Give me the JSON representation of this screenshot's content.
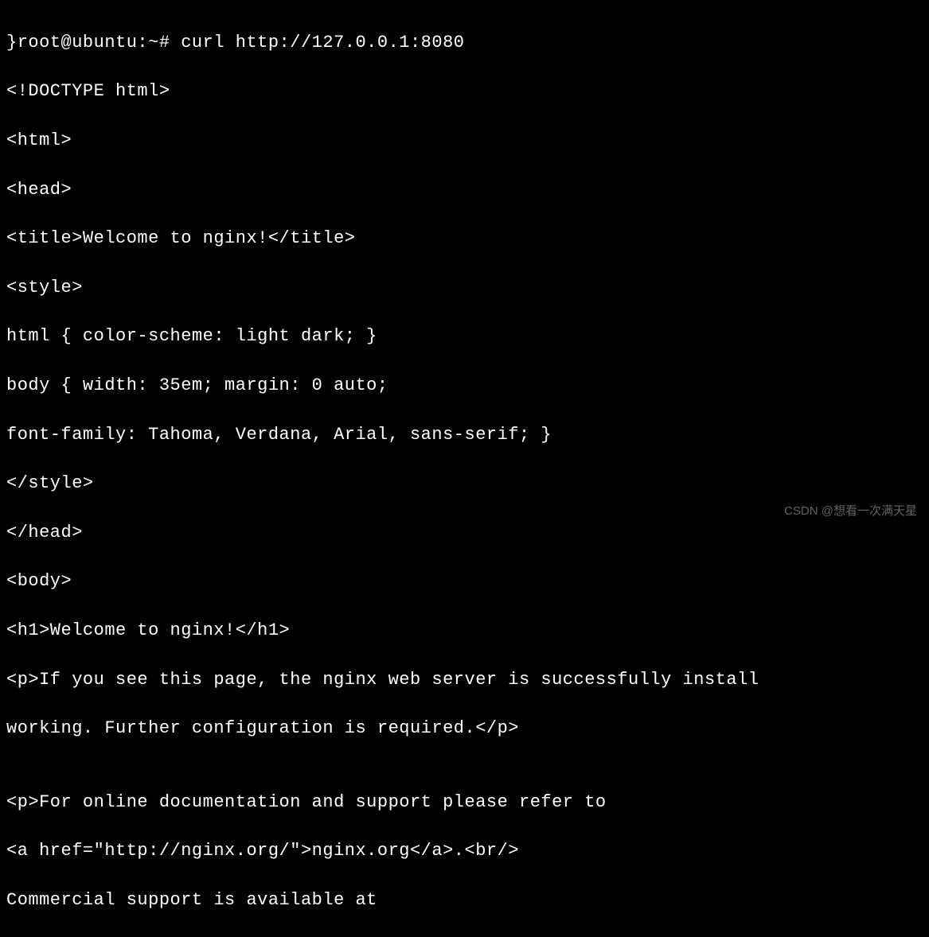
{
  "terminal": {
    "lines": [
      "}root@ubuntu:~# curl http://127.0.0.1:8080",
      "<!DOCTYPE html>",
      "<html>",
      "<head>",
      "<title>Welcome to nginx!</title>",
      "<style>",
      "html { color-scheme: light dark; }",
      "body { width: 35em; margin: 0 auto;",
      "font-family: Tahoma, Verdana, Arial, sans-serif; }",
      "</style>",
      "</head>",
      "<body>",
      "<h1>Welcome to nginx!</h1>",
      "<p>If you see this page, the nginx web server is successfully install",
      "working. Further configuration is required.</p>",
      "",
      "<p>For online documentation and support please refer to",
      "<a href=\"http://nginx.org/\">nginx.org</a>.<br/>",
      "Commercial support is available at"
    ]
  },
  "watermark": {
    "text": "CSDN @想看一次满天星"
  }
}
